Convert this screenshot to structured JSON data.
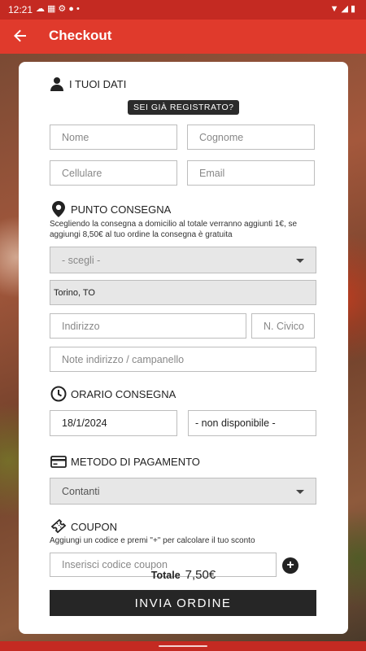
{
  "status_bar": {
    "time": "12:21",
    "left_icons": [
      "cloud-icon",
      "calendar-icon",
      "gear-icon",
      "circle-icon",
      "dot-icon"
    ],
    "right_icons": [
      "wifi-icon",
      "signal-icon",
      "battery-icon"
    ]
  },
  "app_bar": {
    "title": "Checkout",
    "back_icon": "arrow-left-icon"
  },
  "sections": {
    "personal": {
      "title": "I TUOI DATI",
      "icon": "person-icon"
    },
    "delivery": {
      "title": "PUNTO CONSEGNA",
      "icon": "map-pin-icon",
      "note": "Scegliendo la consegna a domicilio al totale verranno aggiunti 1€, se aggiungi 8,50€ al tuo ordine la consegna è gratuita"
    },
    "time": {
      "title": "ORARIO CONSEGNA",
      "icon": "clock-icon"
    },
    "payment": {
      "title": "METODO DI PAGAMENTO",
      "icon": "credit-card-icon"
    },
    "coupon": {
      "title": "COUPON",
      "icon": "ticket-icon",
      "note": "Aggiungi un codice e premi \"+\" per calcolare il tuo sconto"
    }
  },
  "registered_badge": "SEI GIÀ REGISTRATO?",
  "form": {
    "nome_placeholder": "Nome",
    "cognome_placeholder": "Cognome",
    "cellulare_placeholder": "Cellulare",
    "email_placeholder": "Email",
    "delivery_select": "- scegli -",
    "city_value": "Torino, TO",
    "indirizzo_placeholder": "Indirizzo",
    "civico_placeholder": "N. Civico",
    "note_placeholder": "Note indirizzo / campanello",
    "date_value": "18/1/2024",
    "time_value": "- non disponibile -",
    "payment_value": "Contanti",
    "coupon_placeholder": "Inserisci codice coupon",
    "coupon_add": "+"
  },
  "total": {
    "label": "Totale",
    "amount": "7,50€"
  },
  "submit_label": "INVIA ORDINE"
}
